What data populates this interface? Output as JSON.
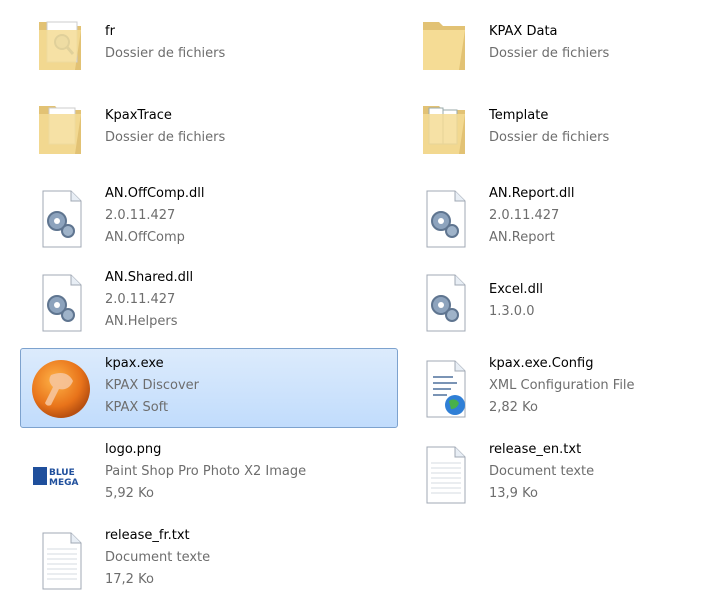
{
  "items": [
    {
      "name": "fr",
      "line1": "Dossier de fichiers",
      "line2": "",
      "icon": "folder-icon"
    },
    {
      "name": "KPAX Data",
      "line1": "Dossier de fichiers",
      "line2": "",
      "icon": "folder-icon"
    },
    {
      "name": "KpaxTrace",
      "line1": "Dossier de fichiers",
      "line2": "",
      "icon": "folder-icon"
    },
    {
      "name": "Template",
      "line1": "Dossier de fichiers",
      "line2": "",
      "icon": "folder-icon"
    },
    {
      "name": "AN.OffComp.dll",
      "line1": "2.0.11.427",
      "line2": "AN.OffComp",
      "icon": "dll-gear-icon"
    },
    {
      "name": "AN.Report.dll",
      "line1": "2.0.11.427",
      "line2": "AN.Report",
      "icon": "dll-gear-icon"
    },
    {
      "name": "AN.Shared.dll",
      "line1": "2.0.11.427",
      "line2": "AN.Helpers",
      "icon": "dll-gear-icon"
    },
    {
      "name": "Excel.dll",
      "line1": "1.3.0.0",
      "line2": "",
      "icon": "dll-gear-icon"
    },
    {
      "name": "kpax.exe",
      "line1": "KPAX Discover",
      "line2": "KPAX Soft",
      "icon": "kpax-app-icon",
      "selected": true
    },
    {
      "name": "kpax.exe.Config",
      "line1": "XML Configuration File",
      "line2": "2,82 Ko",
      "icon": "xml-config-icon"
    },
    {
      "name": "logo.png",
      "line1": "Paint Shop Pro Photo X2 Image",
      "line2": "5,92 Ko",
      "icon": "bluemega-logo-icon",
      "logo_text": [
        "BLUE",
        "MEGA"
      ]
    },
    {
      "name": "release_en.txt",
      "line1": "Document texte",
      "line2": "13,9 Ko",
      "icon": "text-document-icon"
    },
    {
      "name": "release_fr.txt",
      "line1": "Document texte",
      "line2": "17,2 Ko",
      "icon": "text-document-icon"
    }
  ],
  "colors": {
    "selection_border": "#7da2ce",
    "selection_fill": "#c1dcfc",
    "secondary_text": "#6d6d6d"
  }
}
